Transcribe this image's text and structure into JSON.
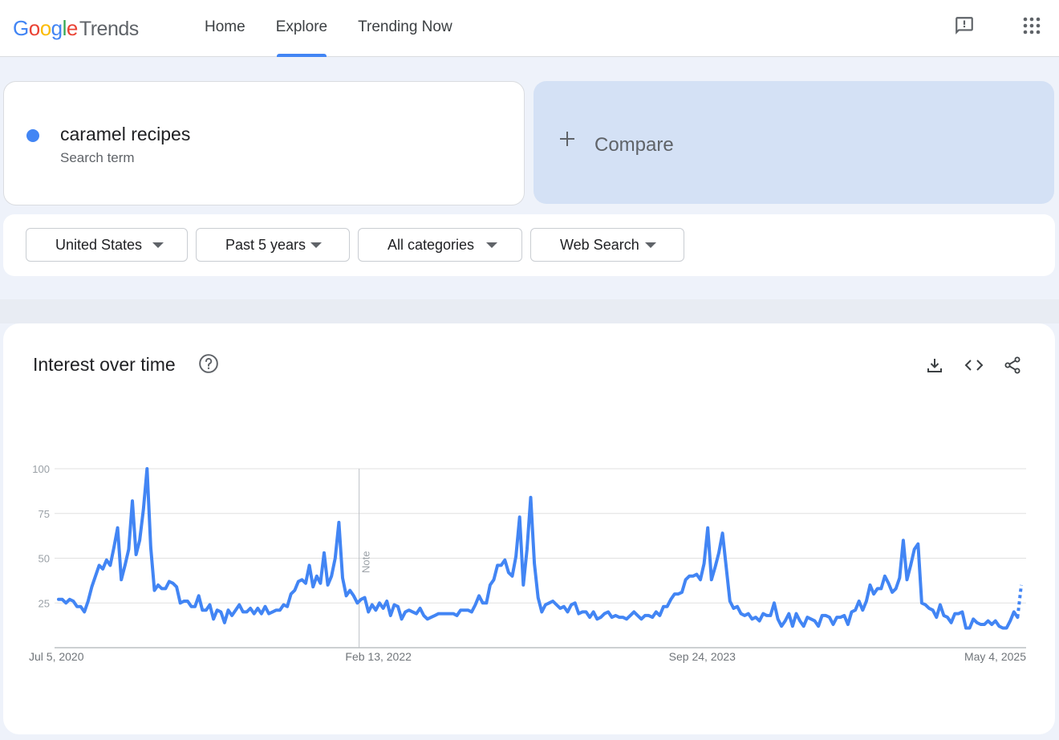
{
  "app": {
    "logo_google": [
      "G",
      "o",
      "o",
      "g",
      "l",
      "e"
    ],
    "logo_trends": "Trends"
  },
  "nav": {
    "tabs": [
      {
        "label": "Home",
        "active": false
      },
      {
        "label": "Explore",
        "active": true
      },
      {
        "label": "Trending Now",
        "active": false
      }
    ]
  },
  "header_icons": [
    "feedback-icon",
    "apps-grid-icon"
  ],
  "search_term": {
    "name": "caramel recipes",
    "type": "Search term",
    "color": "#4285f4"
  },
  "compare": {
    "label": "Compare"
  },
  "filters": {
    "region": "United States",
    "time_range": "Past 5 years",
    "category": "All categories",
    "property": "Web Search"
  },
  "interest_over_time": {
    "title": "Interest over time",
    "icons": [
      "help-icon",
      "download-icon",
      "embed-icon",
      "share-icon"
    ],
    "note_label": "Note"
  },
  "colors": {
    "accent": "#4285f4",
    "compare_bg": "#d4e1f5"
  },
  "chart_data": {
    "type": "line",
    "title": "Interest over time",
    "xlabel": "",
    "ylabel": "",
    "ylim": [
      0,
      100
    ],
    "y_ticks": [
      "100",
      "75",
      "50",
      "25"
    ],
    "x_tick_labels": [
      "Jul 5, 2020",
      "Feb 13, 2022",
      "Sep 24, 2023",
      "May 4, 2025"
    ],
    "x_start": "2020-07-05",
    "x_end": "2025-05-04",
    "note_date": "2022-01-09",
    "grid": true,
    "series": [
      {
        "name": "caramel recipes",
        "color": "#4285f4",
        "partial_last_point": true,
        "values": [
          27,
          27,
          25,
          27,
          26,
          23,
          23,
          20,
          26,
          34,
          40,
          46,
          44,
          49,
          46,
          56,
          67,
          38,
          46,
          55,
          82,
          52,
          60,
          77,
          100,
          56,
          32,
          35,
          33,
          33,
          37,
          36,
          34,
          25,
          26,
          26,
          23,
          23,
          29,
          21,
          21,
          24,
          16,
          21,
          20,
          14,
          21,
          18,
          21,
          24,
          20,
          20,
          22,
          19,
          22,
          19,
          23,
          19,
          20,
          21,
          21,
          24,
          23,
          30,
          32,
          37,
          38,
          36,
          46,
          34,
          40,
          36,
          53,
          35,
          40,
          50,
          70,
          39,
          29,
          32,
          29,
          25,
          27,
          28,
          20,
          24,
          21,
          25,
          22,
          26,
          18,
          24,
          23,
          16,
          20,
          21,
          20,
          19,
          22,
          18,
          16,
          17,
          18,
          19,
          19,
          19,
          19,
          19,
          18,
          21,
          21,
          21,
          20,
          24,
          29,
          25,
          25,
          35,
          38,
          46,
          46,
          49,
          42,
          40,
          51,
          73,
          35,
          55,
          84,
          47,
          28,
          20,
          24,
          25,
          26,
          24,
          22,
          23,
          20,
          24,
          25,
          19,
          20,
          20,
          17,
          20,
          16,
          17,
          19,
          20,
          17,
          18,
          17,
          17,
          16,
          18,
          20,
          18,
          16,
          18,
          18,
          17,
          20,
          18,
          23,
          23,
          27,
          30,
          30,
          31,
          38,
          40,
          40,
          41,
          38,
          47,
          67,
          38,
          45,
          53,
          64,
          45,
          26,
          22,
          23,
          19,
          18,
          19,
          16,
          17,
          15,
          19,
          18,
          18,
          25,
          16,
          12,
          15,
          19,
          12,
          19,
          15,
          12,
          17,
          16,
          15,
          12,
          18,
          18,
          17,
          13,
          17,
          17,
          18,
          13,
          20,
          21,
          26,
          21,
          26,
          35,
          30,
          33,
          33,
          40,
          36,
          31,
          33,
          39,
          60,
          38,
          46,
          55,
          58,
          25,
          24,
          22,
          21,
          17,
          24,
          18,
          17,
          14,
          19,
          19,
          20,
          11,
          11,
          16,
          14,
          13,
          13,
          15,
          13,
          15,
          12,
          11,
          11,
          15,
          20,
          17,
          35
        ]
      }
    ]
  }
}
